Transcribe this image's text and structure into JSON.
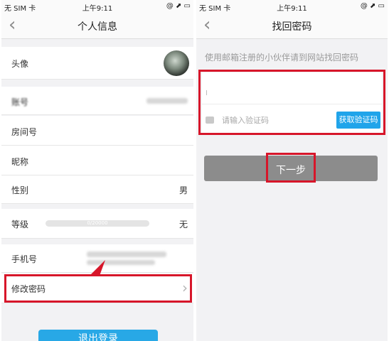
{
  "statusbar": {
    "carrier": "无 SIM 卡",
    "time": "上午9:11"
  },
  "profile": {
    "title": "个人信息",
    "avatar_label": "头像",
    "account_label": "账号",
    "room_label": "房间号",
    "nickname_label": "昵称",
    "gender_label": "性别",
    "gender_value": "男",
    "level_label": "等级",
    "level_progress": "0/20000",
    "level_value": "无",
    "phone_label": "手机号",
    "change_password_label": "修改密码",
    "logout_label": "退出登录"
  },
  "recover": {
    "title": "找回密码",
    "hint": "使用邮箱注册的小伙伴请到网站找回密码",
    "code_placeholder": "请输入验证码",
    "get_code_label": "获取验证码",
    "next_label": "下一步"
  },
  "colors": {
    "accent": "#28a8e6",
    "highlight": "#d7162a",
    "next_button": "#8c8c8c"
  }
}
